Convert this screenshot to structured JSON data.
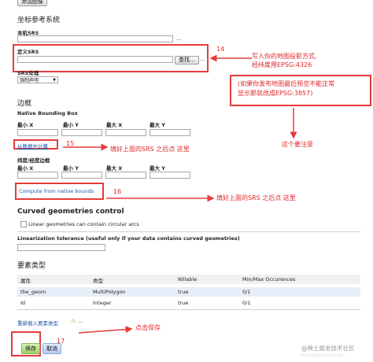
{
  "top_button": "添加图像",
  "crs": {
    "section_title": "坐标参考系统",
    "native_srs_label": "本机SRS",
    "declared_srs_label": "定义SRS",
    "find_button": "查找...",
    "srs_handling_label": "SRS处理",
    "srs_handling_value": "强制声明",
    "ellipsis": "..."
  },
  "bbox": {
    "section_title": "边框",
    "native_label": "Native Bounding Box",
    "columns": [
      "最小 X",
      "最小 Y",
      "最大 X",
      "最大 Y"
    ],
    "compute_from_data": "从数据中计算",
    "latlon_label": "纬度/经度边框",
    "compute_from_native": "Compute from native bounds"
  },
  "curved": {
    "title": "Curved geometries control",
    "checkbox_label": "Linear geometries can contain circular arcs",
    "linearization_label": "Linearization tolerance (useful only if your data contains curved geometries)"
  },
  "feature_type": {
    "title": "要素类型",
    "headers": [
      "属性",
      "类型",
      "Nillable",
      "Min/Max Occurences"
    ],
    "rows": [
      {
        "attr": "the_geom",
        "type": "MultiPolygon",
        "nillable": "true",
        "occ": "0/1"
      },
      {
        "attr": "Id",
        "type": "Integer",
        "nillable": "true",
        "occ": "0/1"
      }
    ],
    "reload": "重新载入要素类型"
  },
  "actions": {
    "save": "保存",
    "cancel": "取消"
  },
  "annotations": {
    "n14": "14",
    "note14": "写入你的地图投影方式,\n经纬度用EPSG:4326",
    "note_alt": "(如果你发布地图最后预览不能正常\n显示那就改成EPSG:3857)",
    "note_attention": "这个要注意",
    "n15": "15",
    "note15": "填好上面的SRS 之后点 这里",
    "n16": "16",
    "note16": "填好上面的SRS 之后点 这里",
    "note_save": "点击保存",
    "n17": "17"
  },
  "watermark": "@稀土掘金技术社区",
  "watermark_url": "https://blog.csdn.net/..."
}
